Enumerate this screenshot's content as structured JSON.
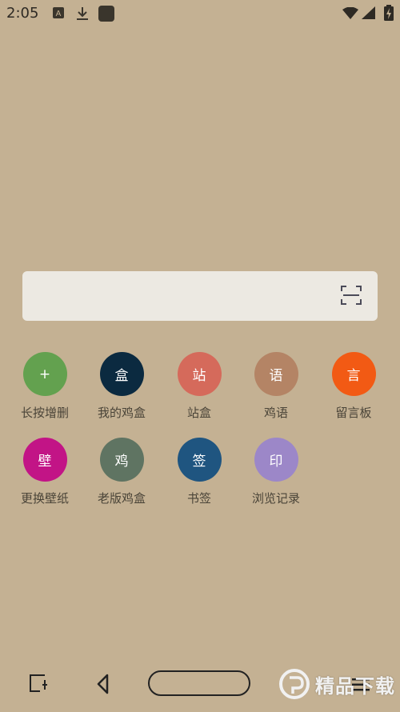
{
  "status_bar": {
    "time": "2:05"
  },
  "search": {
    "placeholder": "",
    "scan_icon": "scan-icon"
  },
  "grid": [
    {
      "id": "long-press-edit",
      "icon_text": "+",
      "label": "长按增删",
      "color": "#63a14f"
    },
    {
      "id": "my-box",
      "icon_text": "盒",
      "label": "我的鸡盒",
      "color": "#0b2a40"
    },
    {
      "id": "site-box",
      "icon_text": "站",
      "label": "站盒",
      "color": "#d56a5b"
    },
    {
      "id": "chicken-talk",
      "icon_text": "语",
      "label": "鸡语",
      "color": "#b48465"
    },
    {
      "id": "message-board",
      "icon_text": "言",
      "label": "留言板",
      "color": "#f25a14"
    },
    {
      "id": "wallpaper",
      "icon_text": "壁",
      "label": "更换壁纸",
      "color": "#c21486"
    },
    {
      "id": "old-box",
      "icon_text": "鸡",
      "label": "老版鸡盒",
      "color": "#5f7462"
    },
    {
      "id": "bookmarks",
      "icon_text": "签",
      "label": "书签",
      "color": "#1f5580"
    },
    {
      "id": "history",
      "icon_text": "印",
      "label": "浏览记录",
      "color": "#9c87c8"
    }
  ],
  "watermark": {
    "text": "精品下载"
  }
}
